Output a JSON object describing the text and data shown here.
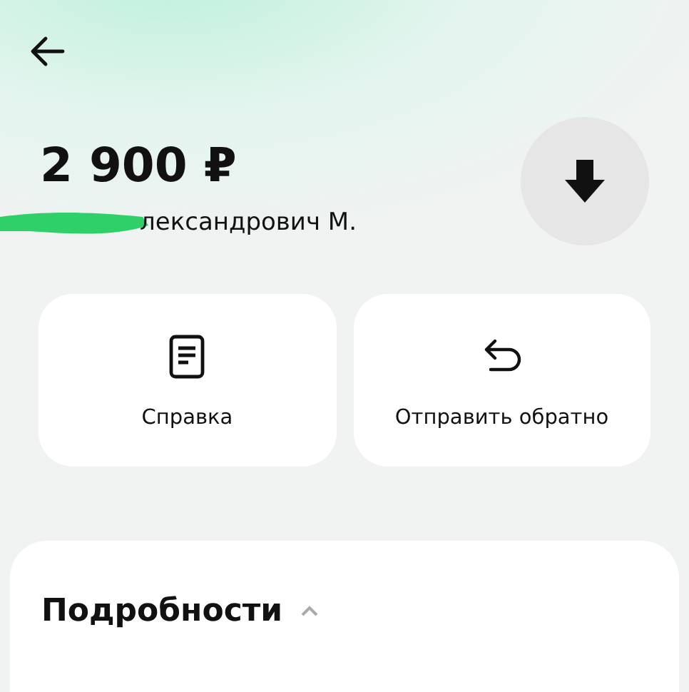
{
  "header": {
    "amount": "2 900 ₽",
    "name": "лександрович М."
  },
  "actions": [
    {
      "kind": "document",
      "label": "Справка"
    },
    {
      "kind": "return",
      "label": "Отправить обратно"
    }
  ],
  "details": {
    "title": "Подробности",
    "expanded": true
  }
}
